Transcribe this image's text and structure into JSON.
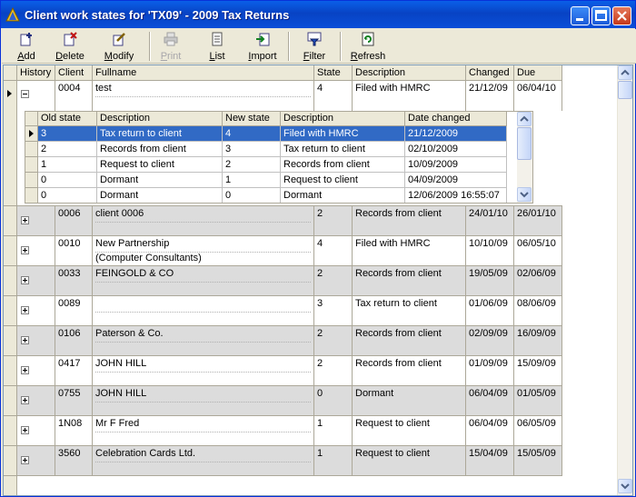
{
  "window": {
    "title": "Client work states for 'TX09' - 2009 Tax Returns"
  },
  "toolbar": {
    "add": "Add",
    "delete": "Delete",
    "modify": "Modify",
    "print": "Print",
    "list": "List",
    "import": "Import",
    "filter": "Filter",
    "refresh": "Refresh"
  },
  "grid": {
    "headers": [
      "History",
      "Client",
      "Fullname",
      "State",
      "Description",
      "Changed",
      "Due"
    ],
    "expanded_row": {
      "client": "0004",
      "fullname": "test",
      "state": "4",
      "description": "Filed with HMRC",
      "changed": "21/12/09",
      "due": "06/04/10"
    },
    "rows": [
      {
        "client": "0006",
        "fullname": "client 0006",
        "fullname2": "",
        "state": "2",
        "description": "Records from client",
        "changed": "24/01/10",
        "due": "26/01/10"
      },
      {
        "client": "0010",
        "fullname": "New Partnership",
        "fullname2": "(Computer Consultants)",
        "state": "4",
        "description": "Filed with HMRC",
        "changed": "10/10/09",
        "due": "06/05/10"
      },
      {
        "client": "0033",
        "fullname": "FEINGOLD & CO",
        "fullname2": "",
        "state": "2",
        "description": "Records from client",
        "changed": "19/05/09",
        "due": "02/06/09"
      },
      {
        "client": "0089",
        "fullname": "",
        "fullname2": "",
        "state": "3",
        "description": "Tax return to client",
        "changed": "01/06/09",
        "due": "08/06/09"
      },
      {
        "client": "0106",
        "fullname": "Paterson & Co.",
        "fullname2": "",
        "state": "2",
        "description": "Records from client",
        "changed": "02/09/09",
        "due": "16/09/09"
      },
      {
        "client": "0417",
        "fullname": "JOHN HILL",
        "fullname2": "",
        "state": "2",
        "description": "Records from client",
        "changed": "01/09/09",
        "due": "15/09/09"
      },
      {
        "client": "0755",
        "fullname": "JOHN HILL",
        "fullname2": "",
        "state": "0",
        "description": "Dormant",
        "changed": "06/04/09",
        "due": "01/05/09"
      },
      {
        "client": "1N08",
        "fullname": "Mr F Fred",
        "fullname2": "",
        "state": "1",
        "description": "Request to client",
        "changed": "06/04/09",
        "due": "06/05/09"
      },
      {
        "client": "3560",
        "fullname": "Celebration Cards Ltd.",
        "fullname2": "",
        "state": "1",
        "description": "Request to client",
        "changed": "15/04/09",
        "due": "15/05/09"
      }
    ]
  },
  "history": {
    "headers": [
      "Old state",
      "Description",
      "New state",
      "Description",
      "Date changed"
    ],
    "rows": [
      {
        "old": "3",
        "old_desc": "Tax return to client",
        "new": "4",
        "new_desc": "Filed with HMRC",
        "date": "21/12/2009"
      },
      {
        "old": "2",
        "old_desc": "Records from client",
        "new": "3",
        "new_desc": "Tax return to client",
        "date": "02/10/2009"
      },
      {
        "old": "1",
        "old_desc": "Request to client",
        "new": "2",
        "new_desc": "Records from client",
        "date": "10/09/2009"
      },
      {
        "old": "0",
        "old_desc": "Dormant",
        "new": "1",
        "new_desc": "Request to client",
        "date": "04/09/2009"
      },
      {
        "old": "0",
        "old_desc": "Dormant",
        "new": "0",
        "new_desc": "Dormant",
        "date": "12/06/2009 16:55:07"
      }
    ]
  }
}
